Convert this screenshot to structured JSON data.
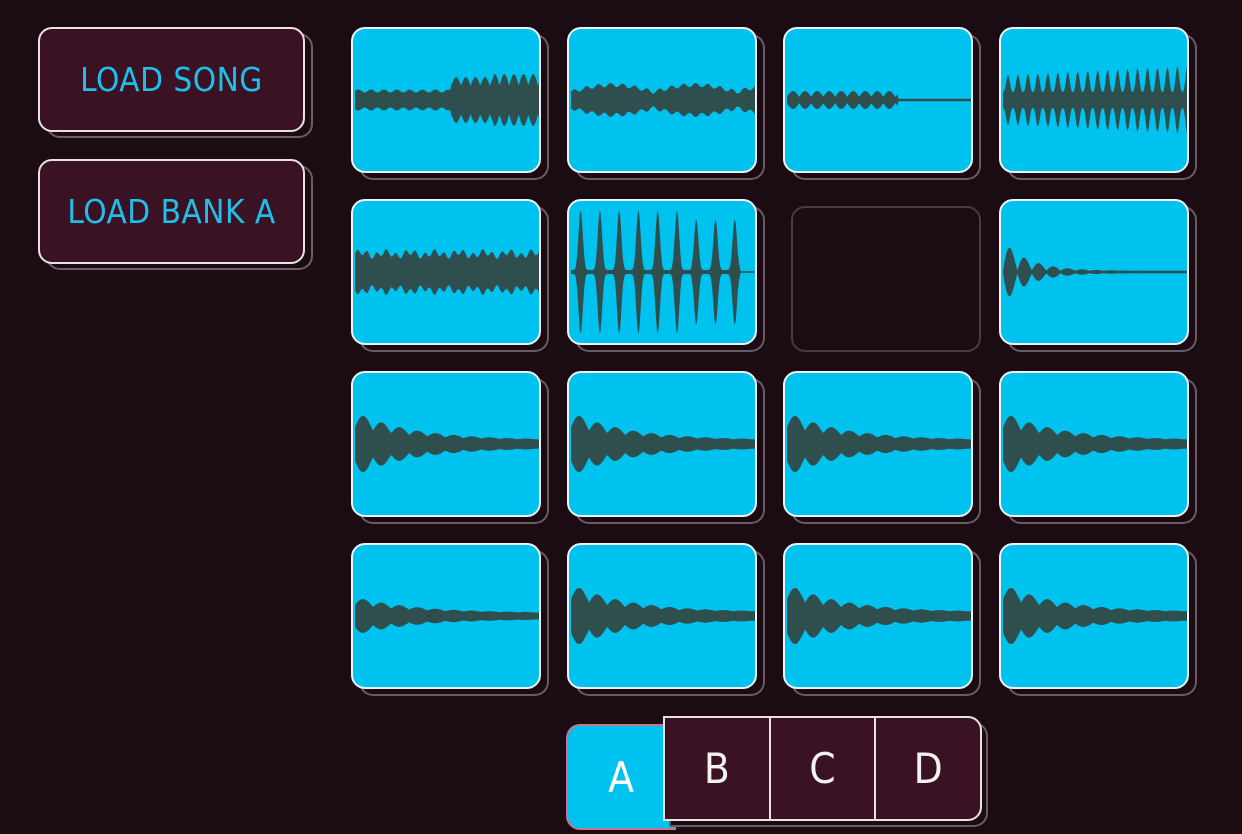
{
  "buttons": {
    "load_song": "LOAD SONG",
    "load_bank": "LOAD BANK A"
  },
  "pads": [
    {
      "id": 1,
      "loaded": true,
      "wave": "pad"
    },
    {
      "id": 2,
      "loaded": true,
      "wave": "swell"
    },
    {
      "id": 3,
      "loaded": true,
      "wave": "short-texture"
    },
    {
      "id": 4,
      "loaded": true,
      "wave": "dense-beat"
    },
    {
      "id": 5,
      "loaded": true,
      "wave": "sustain"
    },
    {
      "id": 6,
      "loaded": true,
      "wave": "spikes"
    },
    {
      "id": 7,
      "loaded": false,
      "wave": ""
    },
    {
      "id": 8,
      "loaded": true,
      "wave": "decay-pluck"
    },
    {
      "id": 9,
      "loaded": true,
      "wave": "decay-hit"
    },
    {
      "id": 10,
      "loaded": true,
      "wave": "decay-hit"
    },
    {
      "id": 11,
      "loaded": true,
      "wave": "decay-hit"
    },
    {
      "id": 12,
      "loaded": true,
      "wave": "decay-hit"
    },
    {
      "id": 13,
      "loaded": true,
      "wave": "decay-soft"
    },
    {
      "id": 14,
      "loaded": true,
      "wave": "decay-hit"
    },
    {
      "id": 15,
      "loaded": true,
      "wave": "decay-hit"
    },
    {
      "id": 16,
      "loaded": true,
      "wave": "decay-hit"
    }
  ],
  "banks": {
    "selected": "A",
    "items": [
      "A",
      "B",
      "C",
      "D"
    ]
  },
  "colors": {
    "background": "#1b0b12",
    "pad": "#00c2ee",
    "waveform": "#2f4f4f",
    "button": "#3a1223",
    "label": "#1ec0ea"
  }
}
